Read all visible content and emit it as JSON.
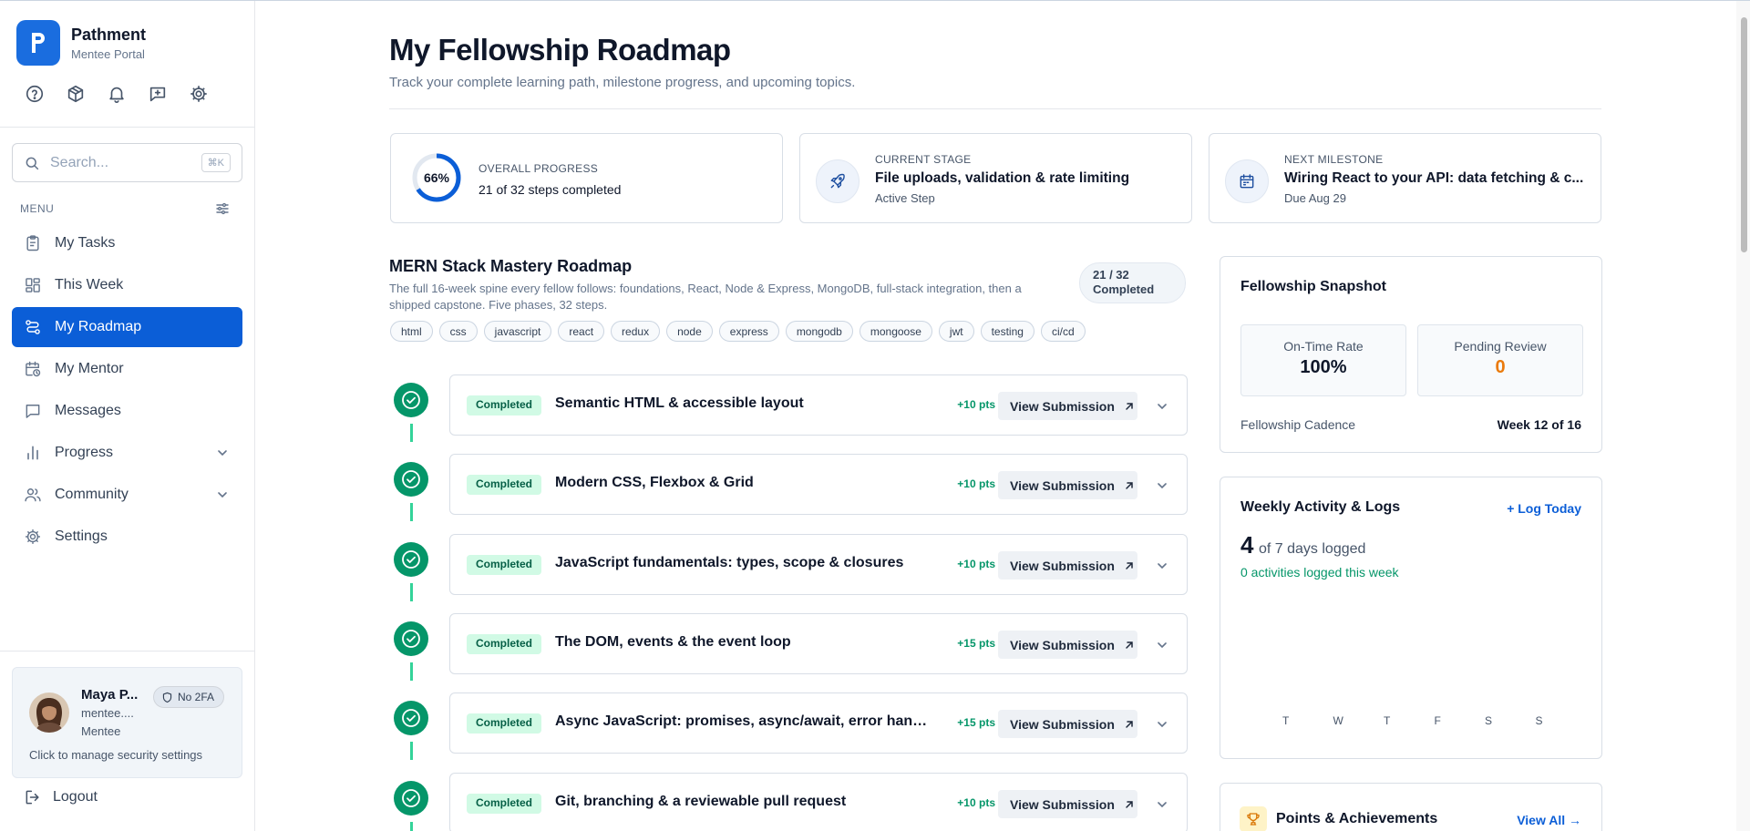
{
  "brand": {
    "name": "Pathment",
    "subtitle": "Mentee Portal"
  },
  "quick_icons": [
    "help-icon",
    "package-icon",
    "bell-icon",
    "feedback-icon",
    "gear-icon"
  ],
  "search": {
    "placeholder": "Search...",
    "shortcut": "⌘K"
  },
  "menu": {
    "heading": "MENU",
    "items": [
      {
        "label": "My Tasks",
        "icon": "clipboard-icon",
        "active": false
      },
      {
        "label": "This Week",
        "icon": "grid-icon",
        "active": false
      },
      {
        "label": "My Roadmap",
        "icon": "route-icon",
        "active": true
      },
      {
        "label": "My Mentor",
        "icon": "calendar-clock-icon",
        "active": false
      },
      {
        "label": "Messages",
        "icon": "message-icon",
        "active": false
      },
      {
        "label": "Progress",
        "icon": "bar-chart-icon",
        "active": false,
        "expandable": true
      },
      {
        "label": "Community",
        "icon": "users-icon",
        "active": false,
        "expandable": true
      },
      {
        "label": "Settings",
        "icon": "gear-icon",
        "active": false
      }
    ]
  },
  "user": {
    "name": "Maya P...",
    "email": "mentee....",
    "role": "Mentee",
    "security_badge": "No 2FA",
    "cta": "Click to manage security settings"
  },
  "logout_label": "Logout",
  "page": {
    "title": "My Fellowship Roadmap",
    "subtitle": "Track your complete learning path, milestone progress, and upcoming topics."
  },
  "stats": {
    "overall": {
      "kicker": "OVERALL PROGRESS",
      "percent_label": "66%",
      "percent": 66,
      "text": "21 of 32 steps completed"
    },
    "current": {
      "kicker": "CURRENT STAGE",
      "title": "File uploads, validation & rate limiting",
      "sub": "Active Step"
    },
    "next": {
      "kicker": "NEXT MILESTONE",
      "title": "Wiring React to your API: data fetching & c...",
      "sub": "Due Aug 29"
    }
  },
  "roadmap": {
    "title": "MERN Stack Mastery Roadmap",
    "description": "The full 16-week spine every fellow follows: foundations, React, Node & Express, MongoDB, full-stack integration, then a shipped capstone. Five phases, 32 steps.",
    "count_line1": "21 / 32",
    "count_line2": "Completed",
    "tags": [
      "html",
      "css",
      "javascript",
      "react",
      "redux",
      "node",
      "express",
      "mongodb",
      "mongoose",
      "jwt",
      "testing",
      "ci/cd"
    ],
    "steps": [
      {
        "status": "Completed",
        "title": "Semantic HTML & accessible layout",
        "points": "+10 pts",
        "action": "View Submission"
      },
      {
        "status": "Completed",
        "title": "Modern CSS, Flexbox & Grid",
        "points": "+10 pts",
        "action": "View Submission"
      },
      {
        "status": "Completed",
        "title": "JavaScript fundamentals: types, scope & closures",
        "points": "+10 pts",
        "action": "View Submission"
      },
      {
        "status": "Completed",
        "title": "The DOM, events & the event loop",
        "points": "+15 pts",
        "action": "View Submission"
      },
      {
        "status": "Completed",
        "title": "Async JavaScript: promises, async/await, error handli...",
        "points": "+15 pts",
        "action": "View Submission"
      },
      {
        "status": "Completed",
        "title": "Git, branching & a reviewable pull request",
        "points": "+10 pts",
        "action": "View Submission"
      }
    ]
  },
  "snapshot": {
    "title": "Fellowship Snapshot",
    "on_time_label": "On-Time Rate",
    "on_time_value": "100%",
    "pending_label": "Pending Review",
    "pending_value": "0",
    "cadence_label": "Fellowship Cadence",
    "cadence_value": "Week 12 of 16"
  },
  "weekly": {
    "title": "Weekly Activity & Logs",
    "link": "+ Log Today",
    "days_logged": "4",
    "days_text": "of 7 days logged",
    "activities": "0 activities logged this week",
    "day_labels": [
      "T",
      "W",
      "T",
      "F",
      "S",
      "S"
    ]
  },
  "points": {
    "title": "Points & Achievements",
    "link": "View All →"
  },
  "colors": {
    "primary": "#0b5ed7",
    "success": "#059669",
    "accent_orange": "#ea7a0c"
  }
}
